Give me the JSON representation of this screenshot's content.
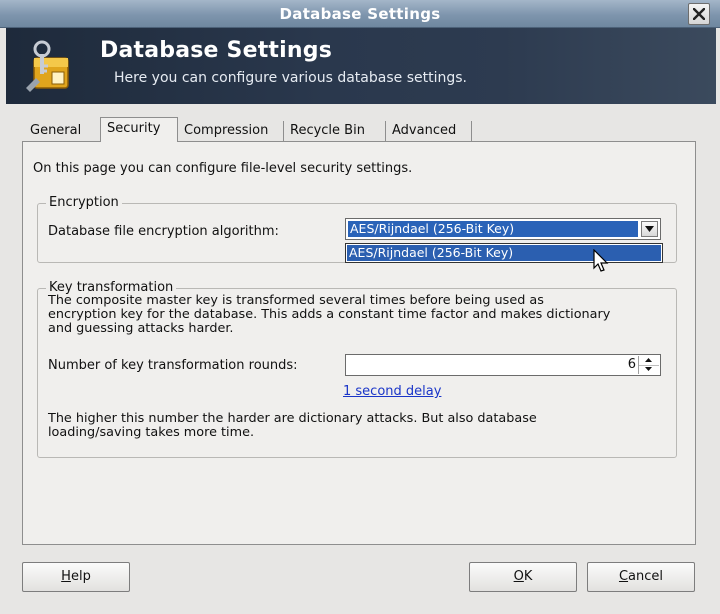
{
  "window": {
    "title": "Database Settings"
  },
  "banner": {
    "title": "Database Settings",
    "subtitle": "Here you can configure various database settings."
  },
  "tabs": [
    {
      "label": "General"
    },
    {
      "label": "Security",
      "active": true
    },
    {
      "label": "Compression"
    },
    {
      "label": "Recycle Bin"
    },
    {
      "label": "Advanced"
    }
  ],
  "security": {
    "intro": "On this page you can configure file-level security settings.",
    "encryption": {
      "group_label": "Encryption",
      "field_label": "Database file encryption algorithm:",
      "selected_value": "AES/Rijndael (256-Bit Key)",
      "open_option": "AES/Rijndael (256-Bit Key)"
    },
    "key_transformation": {
      "group_label": "Key transformation",
      "description_lines": [
        "The composite master key is transformed several times before being used as",
        "encryption key for the database. This adds a constant time factor and makes dictionary",
        "and guessing attacks harder."
      ],
      "rounds_label": "Number of key transformation rounds:",
      "rounds_value": "6",
      "delay_link": "1 second delay",
      "note_lines": [
        "The higher this number the harder are dictionary attacks. But also database",
        "loading/saving takes more time."
      ]
    }
  },
  "buttons": {
    "help": {
      "mnemonic": "H",
      "rest": "elp"
    },
    "ok": {
      "mnemonic": "O",
      "rest": "K"
    },
    "cancel": {
      "mnemonic": "C",
      "rest": "ancel"
    }
  },
  "colors": {
    "selection": "#2a63b8",
    "banner": "#243246",
    "link": "#1a35c8"
  }
}
